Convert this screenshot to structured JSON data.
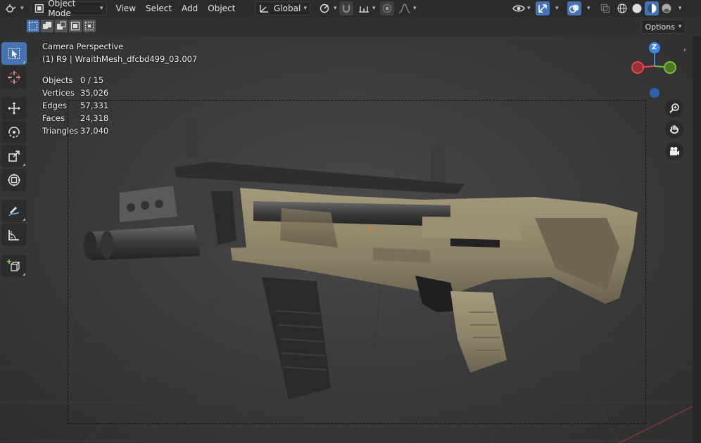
{
  "header": {
    "mode": "Object Mode",
    "menus": [
      "View",
      "Select",
      "Add",
      "Object"
    ],
    "transform_orientation": "Global"
  },
  "subheader": {
    "options_label": "Options"
  },
  "viewport": {
    "camera_label": "Camera Perspective",
    "object_label": "(1) R9 | WraithMesh_dfcbd499_03.007"
  },
  "stats": [
    {
      "label": "Objects",
      "value": "0 / 15"
    },
    {
      "label": "Vertices",
      "value": "35,026"
    },
    {
      "label": "Edges",
      "value": "57,331"
    },
    {
      "label": "Faces",
      "value": "24,318"
    },
    {
      "label": "Triangles",
      "value": "37,040"
    }
  ],
  "gizmo": {
    "z_label": "Z",
    "colors": {
      "x": "#e8474b",
      "y": "#76c03a",
      "z": "#3c88e4"
    }
  },
  "toolbar_tools": [
    "select-box",
    "cursor",
    "move",
    "rotate",
    "scale",
    "transform",
    "annotate",
    "measure",
    "add-cube"
  ],
  "theme": {
    "accent": "#4772b3"
  }
}
